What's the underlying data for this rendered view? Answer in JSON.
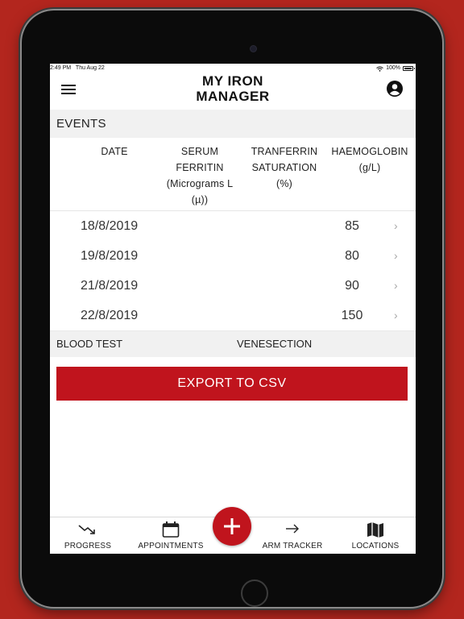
{
  "status_bar": {
    "time": "2:49 PM",
    "date": "Thu Aug 22",
    "battery": "100%"
  },
  "header": {
    "title_line1": "MY IRON",
    "title_line2": "MANAGER"
  },
  "section": {
    "title": "EVENTS"
  },
  "columns": {
    "date": "DATE",
    "ferritin_l1": "SERUM",
    "ferritin_l2": "FERRITIN",
    "ferritin_l3": "(Micrograms L",
    "ferritin_l4": "(µ))",
    "transferrin_l1": "TRANFERRIN",
    "transferrin_l2": "SATURATION",
    "transferrin_l3": "(%)",
    "haemoglobin_l1": "HAEMOGLOBIN",
    "haemoglobin_l2": "(g/L)"
  },
  "rows": [
    {
      "date": "18/8/2019",
      "ferritin": "",
      "transferrin": "",
      "haemoglobin": "85",
      "chevron": "›"
    },
    {
      "date": "19/8/2019",
      "ferritin": "",
      "transferrin": "",
      "haemoglobin": "80",
      "chevron": "›"
    },
    {
      "date": "21/8/2019",
      "ferritin": "",
      "transferrin": "",
      "haemoglobin": "90",
      "chevron": "›"
    },
    {
      "date": "22/8/2019",
      "ferritin": "",
      "transferrin": "",
      "haemoglobin": "150",
      "chevron": "›"
    }
  ],
  "footer": {
    "blood_test": "BLOOD TEST",
    "venesection": "VENESECTION"
  },
  "export_button": "EXPORT TO CSV",
  "tabs": [
    {
      "label": "PROGRESS",
      "icon": "trend-down-icon"
    },
    {
      "label": "APPOINTMENTS",
      "icon": "calendar-icon"
    },
    {
      "label": "ARM TRACKER",
      "icon": "arrow-right-icon"
    },
    {
      "label": "LOCATIONS",
      "icon": "map-icon"
    }
  ],
  "fab_icon": "plus-icon",
  "colors": {
    "background": "#b3261e",
    "accent": "#c0141d",
    "section_bg": "#f1f1f1"
  }
}
